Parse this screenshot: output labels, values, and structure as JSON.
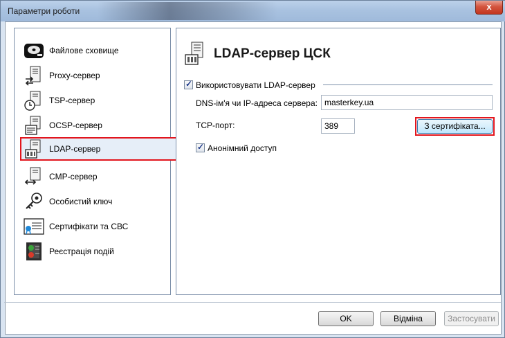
{
  "window": {
    "title": "Параметри роботи",
    "close_glyph": "x"
  },
  "sidebar": {
    "items": [
      {
        "label": "Файлове сховище",
        "icon": "hard-drive-icon"
      },
      {
        "label": "Proxy-сервер",
        "icon": "proxy-server-icon"
      },
      {
        "label": "TSP-сервер",
        "icon": "tsp-server-icon"
      },
      {
        "label": "OCSP-сервер",
        "icon": "ocsp-server-icon"
      },
      {
        "label": "LDAP-сервер",
        "icon": "ldap-server-icon",
        "selected": true
      },
      {
        "label": "CMP-сервер",
        "icon": "cmp-server-icon"
      },
      {
        "label": "Особистий ключ",
        "icon": "key-icon"
      },
      {
        "label": "Сертифікати та СВС",
        "icon": "certificate-icon"
      },
      {
        "label": "Реєстрація подій",
        "icon": "event-log-icon"
      }
    ]
  },
  "main": {
    "title": "LDAP-сервер ЦСК",
    "use_ldap": {
      "label": "Використовувати LDAP-сервер",
      "checked": true
    },
    "dns_label": "DNS-ім'я чи IP-адреса сервера:",
    "dns_value": "masterkey.ua",
    "tcp_label": "TCP-порт:",
    "tcp_value": "389",
    "from_cert_button": "З сертифіката...",
    "anonymous": {
      "label": "Анонімний доступ",
      "checked": true
    }
  },
  "footer": {
    "ok": "OK",
    "cancel": "Відміна",
    "apply": "Застосувати"
  },
  "colors": {
    "highlight": "#e2151d",
    "titlebar": "#a9c2e0"
  }
}
